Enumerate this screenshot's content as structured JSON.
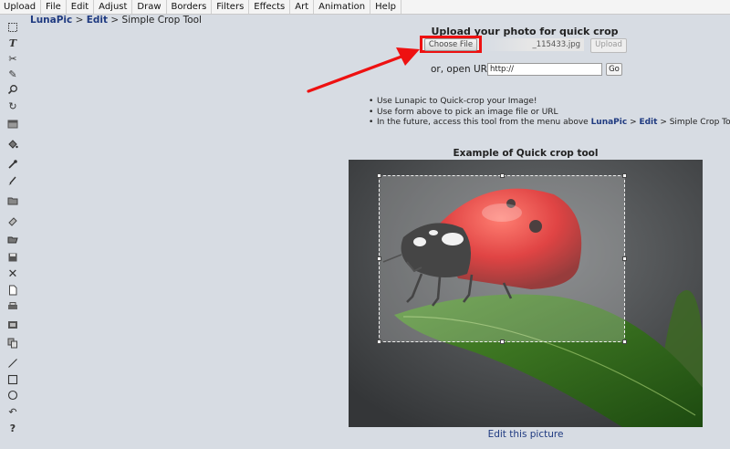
{
  "menu": [
    "Upload",
    "File",
    "Edit",
    "Adjust",
    "Draw",
    "Borders",
    "Filters",
    "Effects",
    "Art",
    "Animation",
    "Help"
  ],
  "breadcrumb": {
    "home": "LunaPic",
    "sep1": " > ",
    "section": "Edit",
    "sep2": " > ",
    "current": "Simple Crop Tool"
  },
  "upload": {
    "title": "Upload your photo for quick crop",
    "choose_label": "Choose File",
    "file_name": "_115433.jpg",
    "upload_label": "Upload",
    "url_label": "or, open URL",
    "url_value": "http://",
    "go_label": "Go"
  },
  "info": {
    "line1": "Use Lunapic to Quick-crop your Image!",
    "line2": "Use form above to pick an image file or URL",
    "line3_prefix": "In the future, access this tool from the menu above ",
    "line3_link1": "LunaPic",
    "line3_sep1": " > ",
    "line3_link2": "Edit",
    "line3_suffix": " > Simple Crop Tool"
  },
  "example": {
    "title": "Example of Quick crop tool",
    "edit_link": "Edit this picture"
  },
  "tools": [
    "marquee-select-icon",
    "text-icon",
    "scissors-icon",
    "pencil-icon",
    "magnifier-icon",
    "rotate-icon",
    "layer-icon",
    "paint-bucket-icon",
    "eyedropper-icon",
    "brush-icon",
    "open-folder-icon",
    "eraser-icon",
    "open-file-icon",
    "save-icon",
    "close-icon",
    "new-document-icon",
    "print-icon",
    "gallery-icon",
    "copy-icon",
    "line-icon",
    "rectangle-icon",
    "circle-icon",
    "undo-icon",
    "help-icon"
  ],
  "colors": {
    "link": "#1f3a80",
    "highlight": "#e11111",
    "background": "#d7dce3"
  }
}
